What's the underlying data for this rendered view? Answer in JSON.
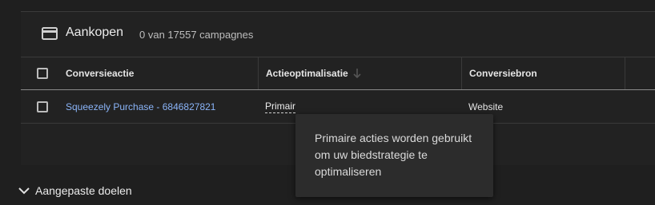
{
  "card": {
    "title": "Aankopen",
    "subtitle": "0 van 17557 campagnes",
    "icon": "card-icon"
  },
  "table": {
    "headers": {
      "name": "Conversieactie",
      "optimization": "Actieoptimalisatie",
      "source": "Conversiebron"
    },
    "rows": [
      {
        "name": "Squeezely Purchase - 6846827821",
        "optimization": "Primair",
        "source": "Website"
      }
    ]
  },
  "tooltip": {
    "text": "Primaire acties worden gebruikt om uw biedstrategie te optimaliseren"
  },
  "footer": {
    "toggle_label": "Aangepaste doelen"
  },
  "colors": {
    "background": "#1f1f1f",
    "link": "#8ab4f8",
    "tooltip_bg": "#2c2c2c"
  }
}
